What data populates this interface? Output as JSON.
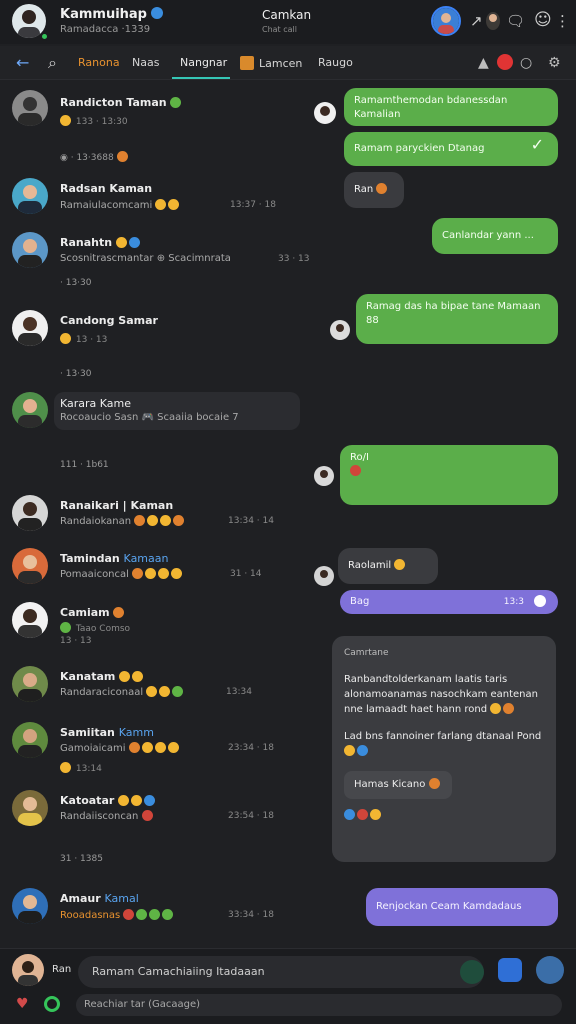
{
  "header": {
    "name": "Kammuihap",
    "subtitle": "Ramadacca ·1339",
    "center_title": "Camkan",
    "center_subtitle": "Chat call"
  },
  "toolbar": {
    "tabs": [
      "Ranona",
      "Naas",
      "Nangnar",
      "Lamcen",
      "Raugo"
    ]
  },
  "chats": [
    {
      "name": "Randicton Taman",
      "meta": "133 · 13:30",
      "icon": "avatar-user-1"
    },
    {
      "name": "Radsan Kaman",
      "sub": "Ramaiulacomcami",
      "time": "13:37 · 18"
    },
    {
      "name": "Ranahtn",
      "sub": "Scosnitrascmantar ⊕ Scacimnrata",
      "time": "33 · 13"
    },
    {
      "name": "Candong Samar",
      "meta": "13 · 13"
    },
    {
      "name": "Karara Kame",
      "sub": "Rocoaucio Sasn 🎮 Scaaiia bocaie 7"
    },
    {
      "name": "Ranaikari | Kaman",
      "sub": "Randaiokanan",
      "time": "13:34 · 14"
    },
    {
      "name": "Tamindan",
      "name_hl": "Kamaan",
      "sub": "Pomaaiconcal",
      "time": "31 · 14"
    },
    {
      "name": "Camiam",
      "meta": "Taao Comso",
      "meta2": "13 · 13"
    },
    {
      "name": "Kanatam",
      "sub": "Randaraciconaal",
      "time": "13:34"
    },
    {
      "name": "Samiitan",
      "name_hl": "Kamm",
      "sub": "Gamoiaicami",
      "meta": "13:14",
      "time": "23:34 · 18"
    },
    {
      "name": "Katoatar",
      "sub": "Randaiisconcan",
      "time": "23:54 · 18"
    },
    {
      "name": "Amaur",
      "name_hl": "Kamal",
      "sub": "Rooadasnas",
      "time": "33:34 · 18"
    }
  ],
  "dividers": {
    "d1": "· 13·3688",
    "d2": "· 13·30",
    "d3": "111 · 1b61",
    "d4": "31 · 1385"
  },
  "bubbles": {
    "b1": "Ramamthemodan bdanessdan Kamalian",
    "b2": "Ramam paryckien Dtanag",
    "b3": "Ran",
    "b4": "Canlandar yann ...",
    "b5": "Ramag das ha bipae tane Mamaan 88",
    "b6_line1": "Ro/I",
    "b7": "Raolamil",
    "b8": "Bag",
    "b8_time": "13:3",
    "card_title": "Camrtane",
    "card_text": "Ranbandtolderkanam laatis taris alonamoanamas nasochkam eantenan nne lamaadt haet hann rond",
    "card_text2": "Lad bns fannoiner farlang dtanaal Pond",
    "card_inner": "Hamas Kicano",
    "b9": "Renjockan Ceam Kamdadaus"
  },
  "composer": {
    "user_label": "Ran",
    "placeholder": "Ramam Camachiaiing Itadaaan",
    "placeholder2": "Reachiar tar (Gacaage)"
  },
  "colors": {
    "accent_green": "#5bae4a",
    "accent_purple": "#7f71d9",
    "link_blue": "#59a3ee",
    "tab_orange": "#e8922f",
    "tab_active": "#35c6b5"
  }
}
